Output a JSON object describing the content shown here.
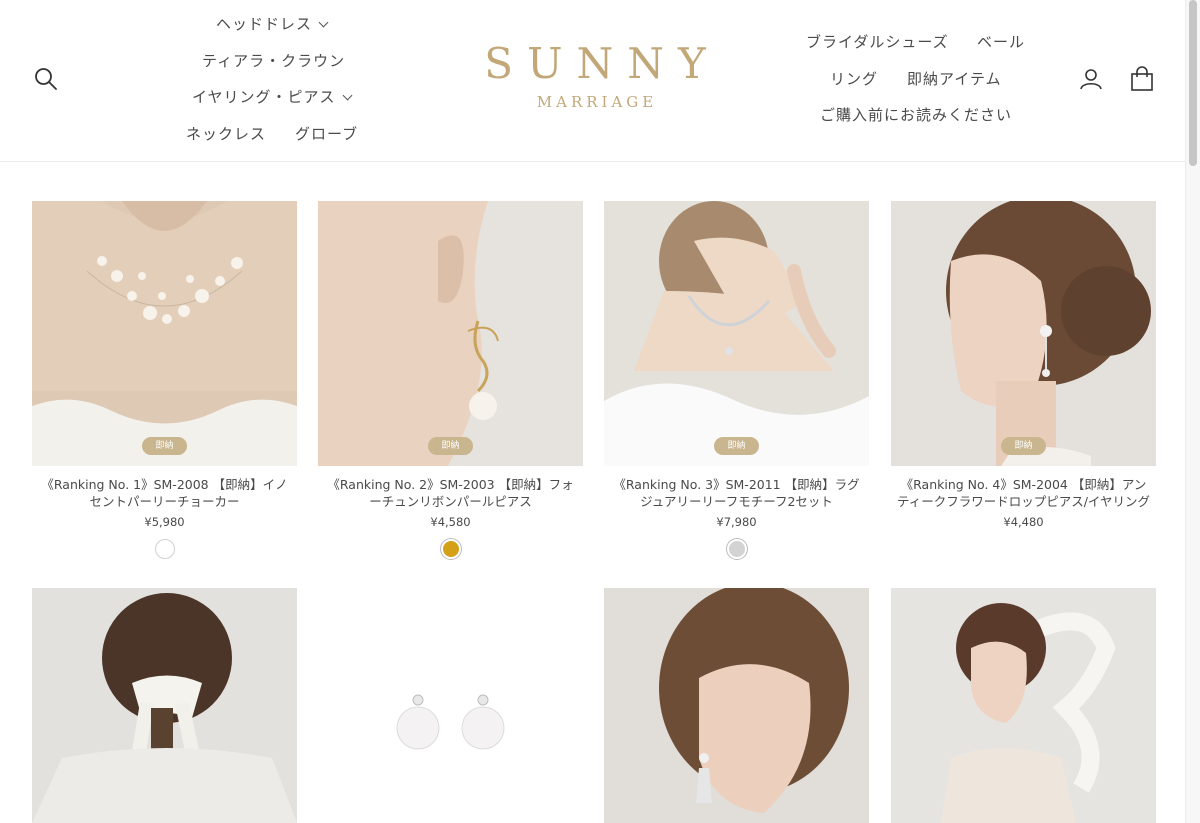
{
  "brand": {
    "name": "SUNNY",
    "tagline": "MARRIAGE",
    "color": "#c2a878"
  },
  "nav_left": [
    {
      "label": "ヘッドドレス",
      "has_dropdown": true
    },
    {
      "label": "ティアラ・クラウン",
      "has_dropdown": false
    },
    {
      "label": "イヤリング・ピアス",
      "has_dropdown": true
    },
    {
      "label": "ネックレス",
      "has_dropdown": false
    },
    {
      "label": "グローブ",
      "has_dropdown": false
    }
  ],
  "nav_right": [
    {
      "label": "ブライダルシューズ"
    },
    {
      "label": "ベール"
    },
    {
      "label": "リング"
    },
    {
      "label": "即納アイテム"
    },
    {
      "label": "ご購入前にお読みください"
    }
  ],
  "icons": {
    "search": "search-icon",
    "account": "user-icon",
    "cart": "cart-icon"
  },
  "products": [
    {
      "badge": "即納",
      "title": "《Ranking No. 1》SM-2008 【即納】イノセントパーリーチョーカー",
      "price": "¥5,980",
      "swatch_color": "#ffffff",
      "image": "pearl-choker-model"
    },
    {
      "badge": "即納",
      "title": "《Ranking No. 2》SM-2003 【即納】フォーチュンリボンパールピアス",
      "price": "¥4,580",
      "swatch_color": "#d4a017",
      "image": "ribbon-pearl-earring-model"
    },
    {
      "badge": "即納",
      "title": "《Ranking No. 3》SM-2011 【即納】ラグジュアリーリーフモチーフ2セット",
      "price": "¥7,980",
      "swatch_color": "#d3d3d3",
      "image": "leaf-necklace-model"
    },
    {
      "badge": "即納",
      "title": "《Ranking No. 4》SM-2004 【即納】アンティークフラワードロップピアス/イヤリング",
      "price": "¥4,480",
      "image": "flower-drop-earring-model"
    },
    {
      "image": "ribbon-headdress-model"
    },
    {
      "image": "pearl-stud-earrings"
    },
    {
      "image": "crystal-earring-model"
    },
    {
      "image": "organza-bow-model"
    }
  ]
}
